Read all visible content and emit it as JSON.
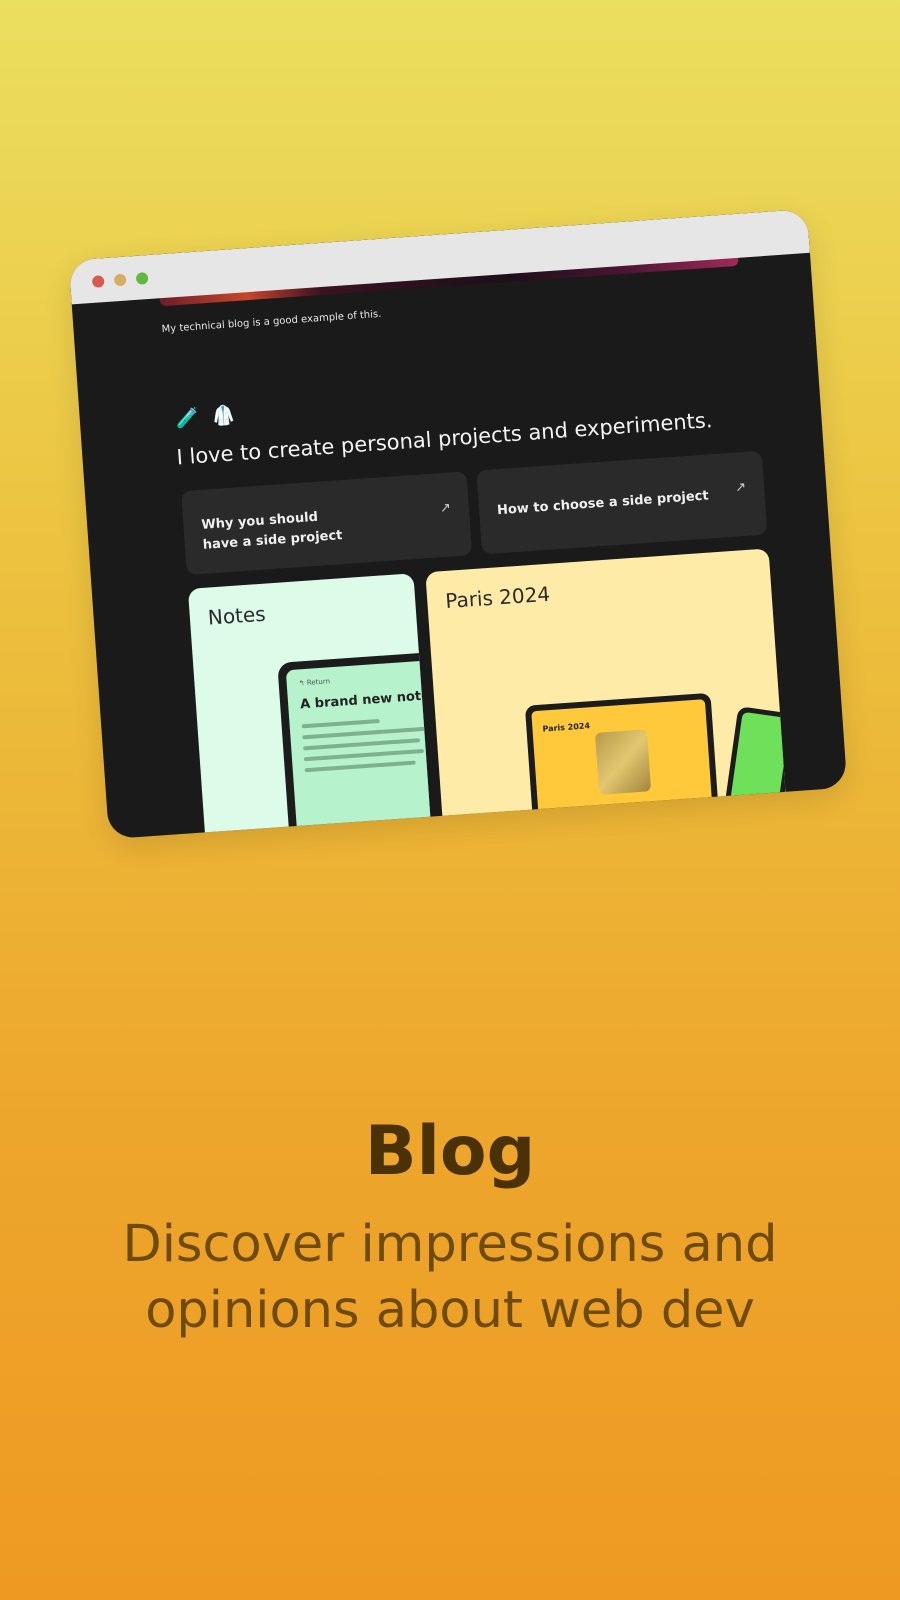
{
  "window": {
    "caption": "My technical blog is a good example of this.",
    "emojis": [
      "🧪",
      "🥼"
    ],
    "headline": "I love to create personal projects and experiments.",
    "links": [
      {
        "label": "Why you should have a side project",
        "arrow": "↗"
      },
      {
        "label": "How to choose a side project",
        "arrow": "↗"
      }
    ],
    "projects": {
      "notes": {
        "title": "Notes",
        "tablet": {
          "back": "↰ Return",
          "note_title": "A brand new note"
        }
      },
      "paris": {
        "title": "Paris 2024",
        "laptop": {
          "title": "Paris 2024"
        }
      }
    }
  },
  "promo": {
    "title": "Blog",
    "subtitle": "Discover impressions and opinions about web dev"
  },
  "colors": {
    "background_top": "#ebdf5f",
    "background_bottom": "#ee9a22",
    "window_bg": "#1a1a1a",
    "title_color": "#4a3206",
    "subtitle_color": "#6e4b0a"
  }
}
